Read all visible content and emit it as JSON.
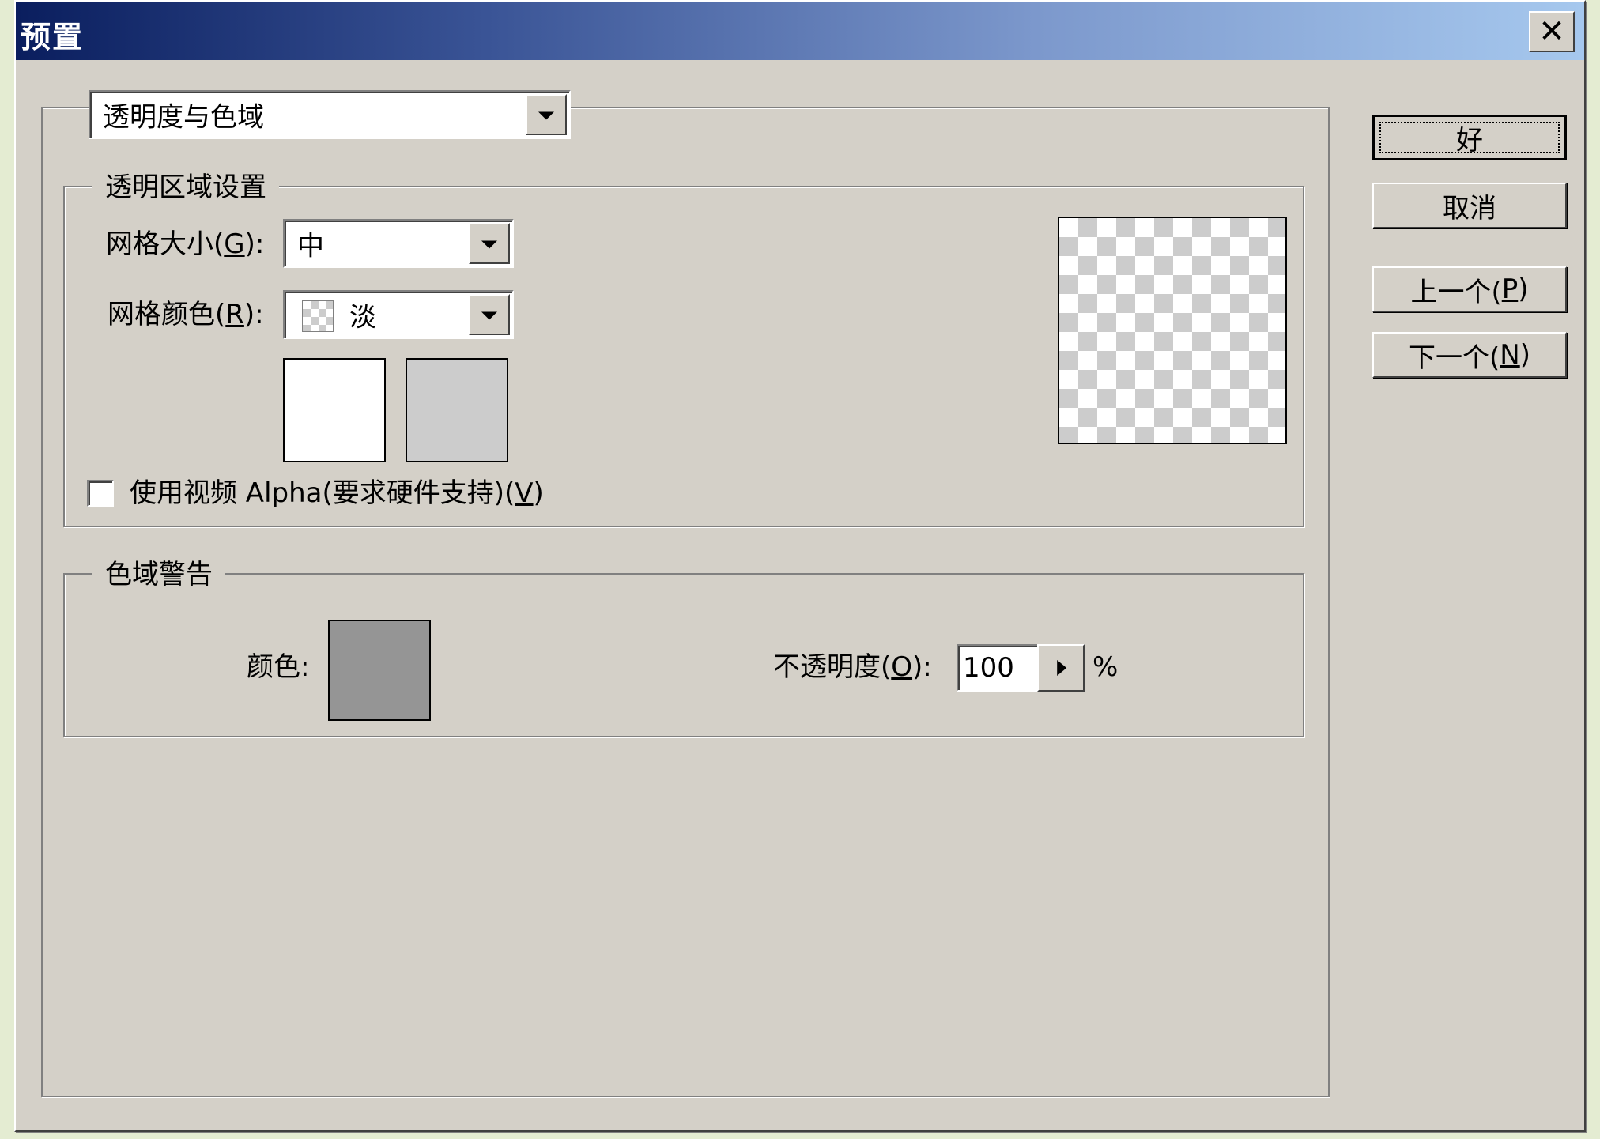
{
  "window": {
    "title": "预置",
    "close_glyph": "✕"
  },
  "category": {
    "selected": "透明度与色域"
  },
  "transparency": {
    "legend": "透明区域设置",
    "grid_size_label": "网格大小(G):",
    "grid_size_value": "中",
    "grid_color_label": "网格颜色(R):",
    "grid_color_value": "淡",
    "swatch1_color": "#ffffff",
    "swatch2_color": "#cccccc",
    "video_alpha_label": "使用视频 Alpha(要求硬件支持)(V)",
    "video_alpha_checked": false
  },
  "gamut": {
    "legend": "色域警告",
    "color_label": "颜色:",
    "color_value": "#959595",
    "opacity_label": "不透明度(O):",
    "opacity_value": "100",
    "opacity_unit": "%"
  },
  "buttons": {
    "ok": "好",
    "cancel": "取消",
    "prev": "上一个(P)",
    "next": "下一个(N)"
  },
  "icons": {
    "close": "close-icon",
    "dropdown": "chevron-down-icon",
    "spin": "triangle-right-icon",
    "grid_color": "checkerboard-icon"
  }
}
